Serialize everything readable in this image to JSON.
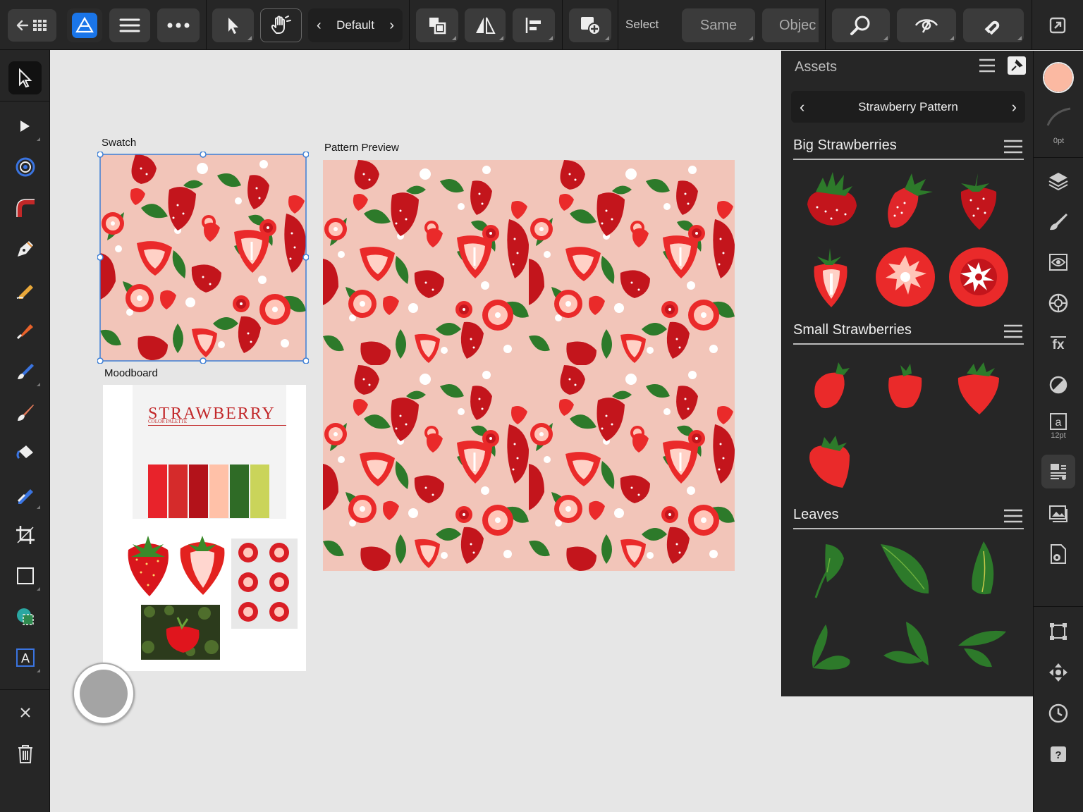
{
  "toolbar": {
    "persona_label": "Default",
    "select_label": "Select",
    "same_label": "Same",
    "object_label": "Objec"
  },
  "artboards": {
    "swatch_label": "Swatch",
    "pattern_preview_label": "Pattern Preview",
    "moodboard_label": "Moodboard",
    "moodboard_title": "STRAWBERRY",
    "moodboard_subtitle": "COLOR PALETTE",
    "palette": [
      "#e8232b",
      "#d52b2b",
      "#b3121a",
      "#ffc1a8",
      "#2f6b26",
      "#cad45a"
    ]
  },
  "assets_panel": {
    "title": "Assets",
    "category_name": "Strawberry Pattern",
    "sections": [
      {
        "name": "Big Strawberries",
        "count": 6
      },
      {
        "name": "Small Strawberries",
        "count": 4
      },
      {
        "name": "Leaves",
        "count": 6
      }
    ]
  },
  "right_panel": {
    "stroke_width": "0pt",
    "font_size": "12pt",
    "fill_color": "#fbb9a2"
  },
  "colors": {
    "accent": "#1a8cff",
    "pattern_bg": "#f2c5b9",
    "strawberry_red": "#c3151c",
    "bright_red": "#ea2a2a",
    "leaf_green": "#2d7a2a"
  }
}
